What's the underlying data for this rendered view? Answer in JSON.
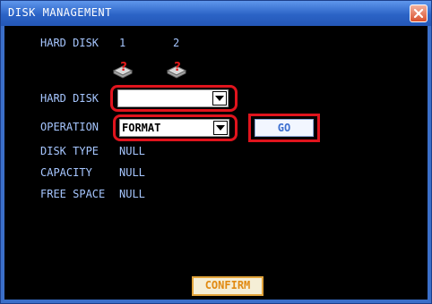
{
  "window": {
    "title": "DISK MANAGEMENT"
  },
  "disk_list": {
    "label": "HARD DISK",
    "disks": [
      {
        "number": "1",
        "icon": "disk-unknown-icon"
      },
      {
        "number": "2",
        "icon": "disk-unknown-icon"
      }
    ]
  },
  "form": {
    "hard_disk_label": "HARD DISK",
    "hard_disk_value": "",
    "operation_label": "OPERATION",
    "operation_value": "FORMAT",
    "go_label": "GO",
    "disk_type_label": "DISK TYPE",
    "disk_type_value": "NULL",
    "capacity_label": "CAPACITY",
    "capacity_value": "NULL",
    "free_space_label": "FREE SPACE",
    "free_space_value": "NULL"
  },
  "footer": {
    "confirm_label": "CONFIRM"
  },
  "colors": {
    "title_bar": "#2b63c6",
    "content_bg": "#000000",
    "label_text": "#a6c6ff",
    "highlight": "#e0141d",
    "confirm_border": "#e2a43b"
  }
}
